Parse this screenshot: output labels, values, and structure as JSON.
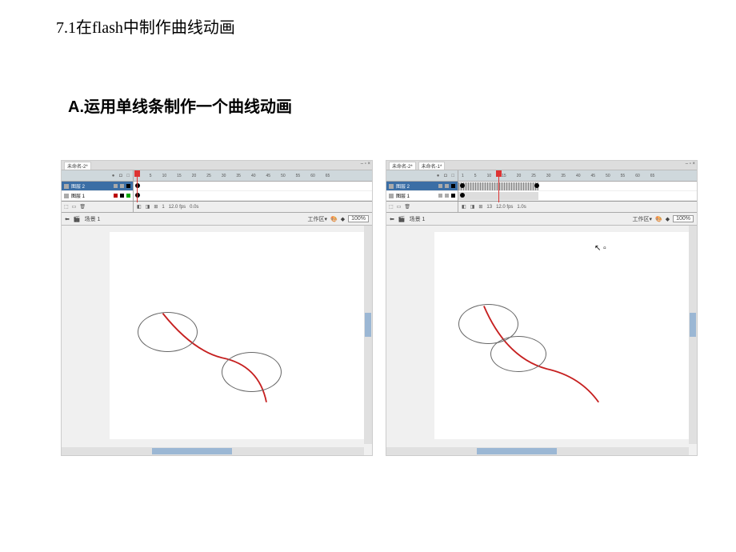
{
  "heading1": "7.1在flash中制作曲线动画",
  "heading2_prefix": "A.",
  "heading2_rest": "运用单线条制作一个曲线动画",
  "flash_left": {
    "tabs": [
      "未命名-2*"
    ],
    "win_controls": "– ▫ ×",
    "eye_lock": "● ◘ □",
    "ruler": [
      "1",
      "5",
      "10",
      "15",
      "20",
      "25",
      "30",
      "35",
      "40",
      "45",
      "50",
      "55",
      "60",
      "65"
    ],
    "layers": [
      {
        "name": "图层 2",
        "selected": true
      },
      {
        "name": "图层 1",
        "selected": false
      }
    ],
    "status_frame": "1",
    "status_fps": "12.0 fps",
    "status_time": "0.0s",
    "scene": "场景 1",
    "workspace": "工作区▾",
    "zoom": "100%",
    "playhead_frame": 1
  },
  "flash_right": {
    "tabs": [
      "未命名-2*",
      "未命名-1*"
    ],
    "win_controls": "– ▫ ×",
    "eye_lock": "● ◘ □",
    "ruler": [
      "1",
      "5",
      "10",
      "15",
      "20",
      "25",
      "30",
      "35",
      "40",
      "45",
      "50",
      "55",
      "60",
      "65"
    ],
    "layers": [
      {
        "name": "图层 2",
        "selected": true
      },
      {
        "name": "图层 1",
        "selected": false
      }
    ],
    "status_frame": "13",
    "status_fps": "12.0 fps",
    "status_time": "1.0s",
    "scene": "场景 1",
    "workspace": "工作区▾",
    "zoom": "100%",
    "playhead_frame": 13,
    "tween_end": 25
  }
}
